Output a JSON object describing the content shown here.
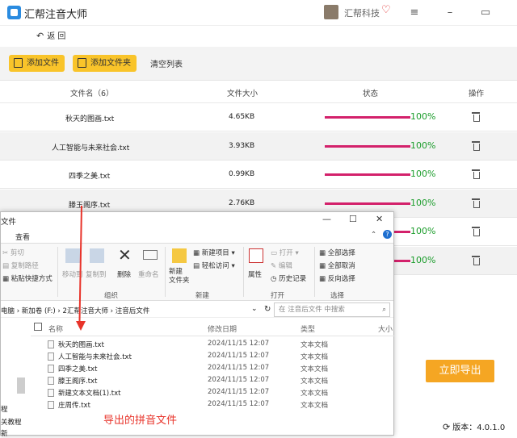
{
  "app": {
    "title": "汇帮注音大师",
    "brand": "汇帮科技"
  },
  "nav": {
    "back": "返 回"
  },
  "toolbar": {
    "add_file": "添加文件",
    "add_folder": "添加文件夹",
    "clear": "清空列表"
  },
  "table": {
    "headers": {
      "name": "文件名（6）",
      "size": "文件大小",
      "status": "状态",
      "action": "操作"
    },
    "rows": [
      {
        "name": "秋天的图画.txt",
        "size": "4.65KB",
        "progress": "100%"
      },
      {
        "name": "人工智能与未来社会.txt",
        "size": "3.93KB",
        "progress": "100%"
      },
      {
        "name": "四季之美.txt",
        "size": "0.99KB",
        "progress": "100%"
      },
      {
        "name": "滕王阁序.txt",
        "size": "2.76KB",
        "progress": "100%"
      },
      {
        "name": "",
        "size": "",
        "progress": "100%"
      },
      {
        "name": "",
        "size": "",
        "progress": "100%"
      }
    ]
  },
  "export_button": "立即导出",
  "version": "版本：4.0.1.0",
  "explorer": {
    "title": "文件",
    "tab": "查看",
    "ribbon": {
      "cut": "剪切",
      "copy_path": "复制路径",
      "paste_shortcut": "粘贴快捷方式",
      "move_to": "移动到",
      "copy_to": "复制到",
      "delete": "删除",
      "rename": "重命名",
      "new_folder": "新建\n文件夹",
      "new_item": "新建项目",
      "easy_access": "轻松访问",
      "properties": "属性",
      "open": "打开",
      "edit": "编辑",
      "history": "历史记录",
      "select_all": "全部选择",
      "select_none": "全部取消",
      "invert": "反向选择",
      "group_organize": "组织",
      "group_new": "新建",
      "group_open": "打开",
      "group_select": "选择"
    },
    "address": "电脑 › 新加卷 (F:) › 2汇帮注音大师 › 注音后文件",
    "search_placeholder": "在 注音后文件 中搜索",
    "columns": {
      "name": "名称",
      "date": "修改日期",
      "type": "类型",
      "size": "大小"
    },
    "files": [
      {
        "name": "秋天的图画.txt",
        "date": "2024/11/15 12:07",
        "type": "文本文档"
      },
      {
        "name": "人工智能与未来社会.txt",
        "date": "2024/11/15 12:07",
        "type": "文本文档"
      },
      {
        "name": "四季之美.txt",
        "date": "2024/11/15 12:07",
        "type": "文本文档"
      },
      {
        "name": "滕王阁序.txt",
        "date": "2024/11/15 12:07",
        "type": "文本文档"
      },
      {
        "name": "新建文本文档(1).txt",
        "date": "2024/11/15 12:07",
        "type": "文本文档"
      },
      {
        "name": "庄周传.txt",
        "date": "2024/11/15 12:07",
        "type": "文本文档"
      }
    ],
    "sidebar": [
      "程",
      "关教程",
      "新"
    ]
  },
  "annotation": "导出的拼音文件",
  "colors": {
    "accent_yellow": "#f9c42a",
    "progress": "#d3216b",
    "export": "#f5a623",
    "annotation": "#e8332a"
  }
}
